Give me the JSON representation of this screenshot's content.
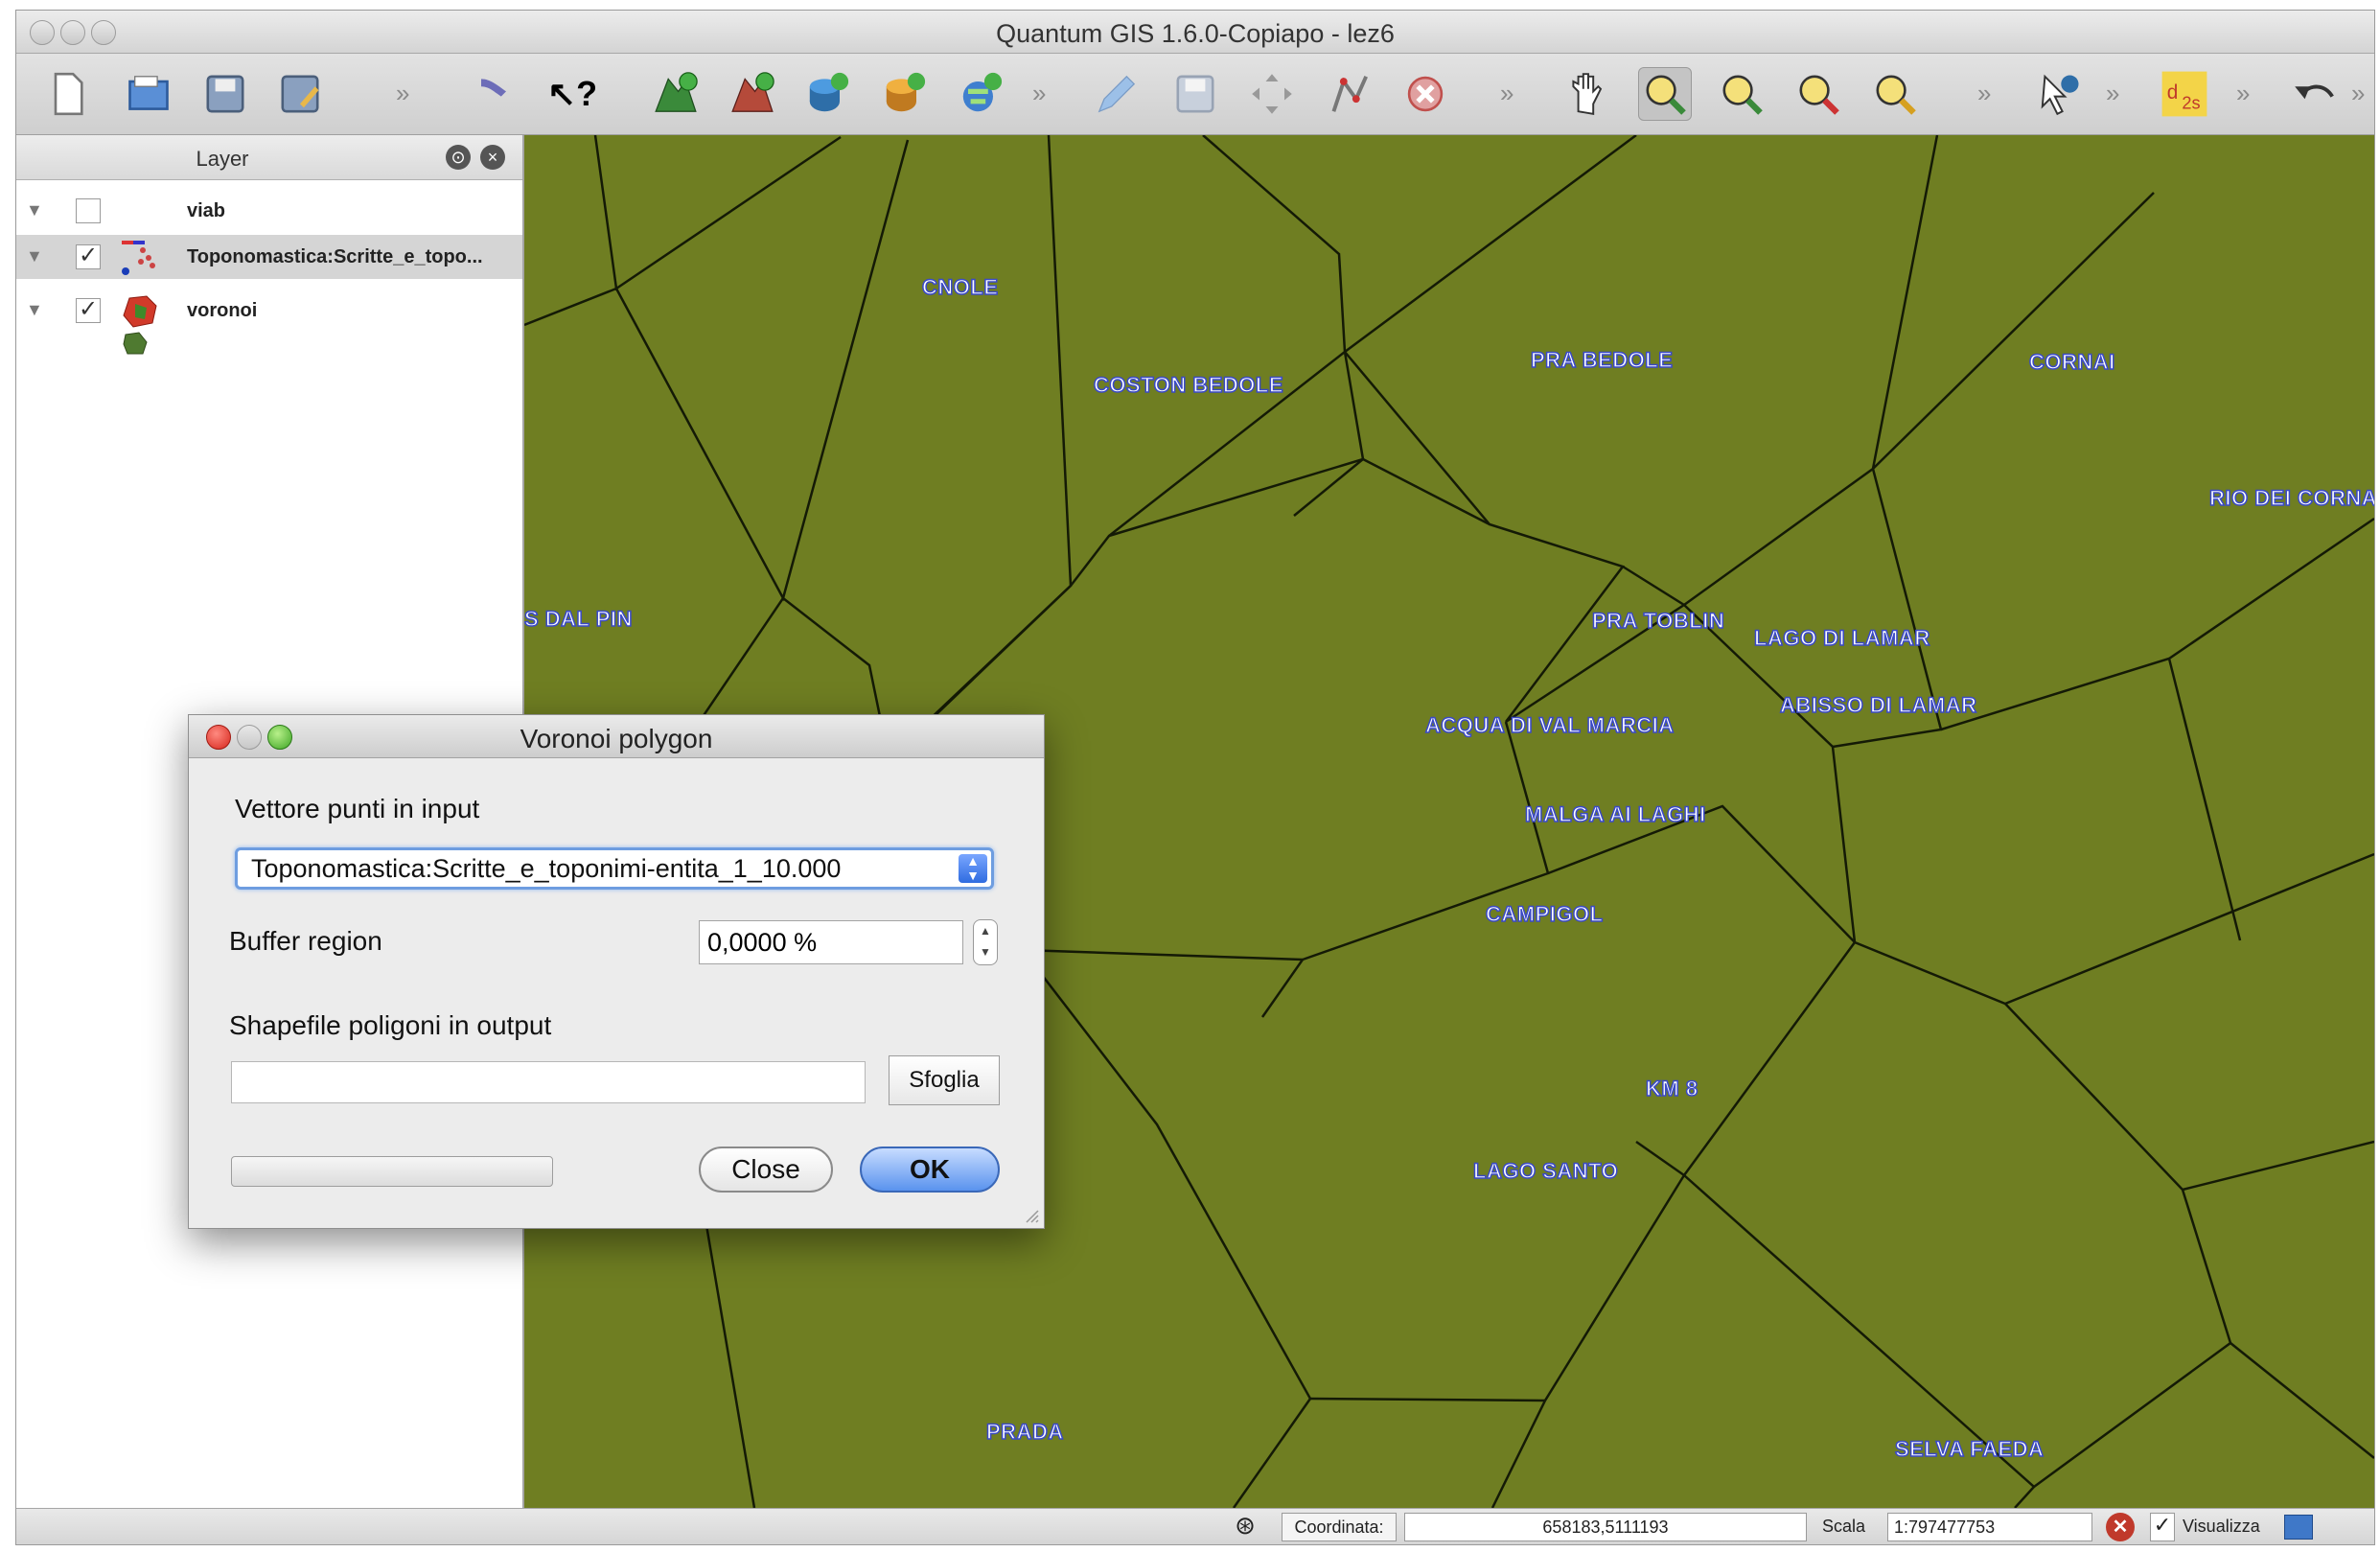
{
  "window": {
    "title": "Quantum GIS 1.6.0-Copiapo - lez6"
  },
  "layer_panel": {
    "title": "Layer",
    "layers": [
      {
        "name": "viab",
        "checked": false
      },
      {
        "name": "Toponomastica:Scritte_e_topo...",
        "checked": true
      },
      {
        "name": "voronoi",
        "checked": true
      }
    ]
  },
  "map_labels": [
    "CNOLE",
    "COSTON BEDOLE",
    "PRA BEDOLE",
    "CORNAI",
    "RIO DEI CORNAI",
    "S DAL PIN",
    "PRA TOBLIN",
    "LAGO DI LAMAR",
    "ABISSO DI LAMAR",
    "ACQUA DI VAL MARCIA",
    "MALGA AI LAGHI",
    "CAMPIGOL",
    "KM 8",
    "LAGO SANTO",
    "PRADA",
    "SELVA FAEDA"
  ],
  "dialog": {
    "title": "Voronoi polygon",
    "input_label": "Vettore punti in input",
    "input_value": "Toponomastica:Scritte_e_toponimi-entita_1_10.000",
    "buffer_label": "Buffer region",
    "buffer_value": "0,0000 %",
    "output_label": "Shapefile poligoni in output",
    "output_value": "",
    "browse_label": "Sfoglia",
    "close_label": "Close",
    "ok_label": "OK"
  },
  "statusbar": {
    "coord_label": "Coordinata:",
    "coord_value": "658183,5111193",
    "scale_label": "Scala",
    "scale_value": "1:797477753",
    "render_label": "Visualizza",
    "render_checked": true
  },
  "colors": {
    "map_fill": "#6f7e22",
    "label_outline": "#3a49c8",
    "dialog_ok": "#5a93ee"
  }
}
